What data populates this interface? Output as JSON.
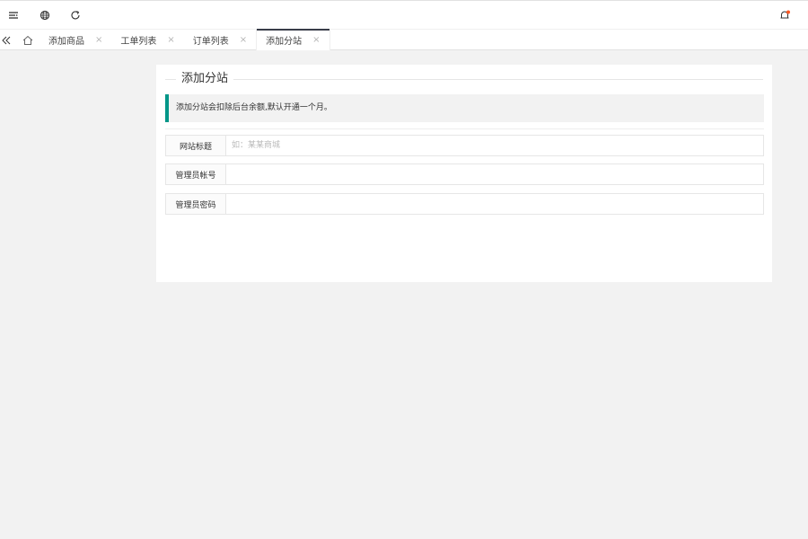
{
  "header": {
    "icons": [
      "menu-icon",
      "globe-icon",
      "refresh-icon",
      "bell-icon"
    ],
    "notification_dot_color": "#ff5722"
  },
  "tabbar": {
    "tabs": [
      {
        "label": "添加商品",
        "active": false
      },
      {
        "label": "工单列表",
        "active": false
      },
      {
        "label": "订单列表",
        "active": false
      },
      {
        "label": "添加分站",
        "active": true
      }
    ],
    "close_glyph": "×"
  },
  "page": {
    "title": "添加分站",
    "notice": "添加分站会扣除后台余额,默认开通一个月。",
    "accent_color": "#009688",
    "fields": [
      {
        "label": "网站标题",
        "placeholder": "如：某某商城",
        "value": ""
      },
      {
        "label": "管理员帐号",
        "placeholder": "",
        "value": ""
      },
      {
        "label": "管理员密码",
        "placeholder": "",
        "value": ""
      }
    ]
  }
}
